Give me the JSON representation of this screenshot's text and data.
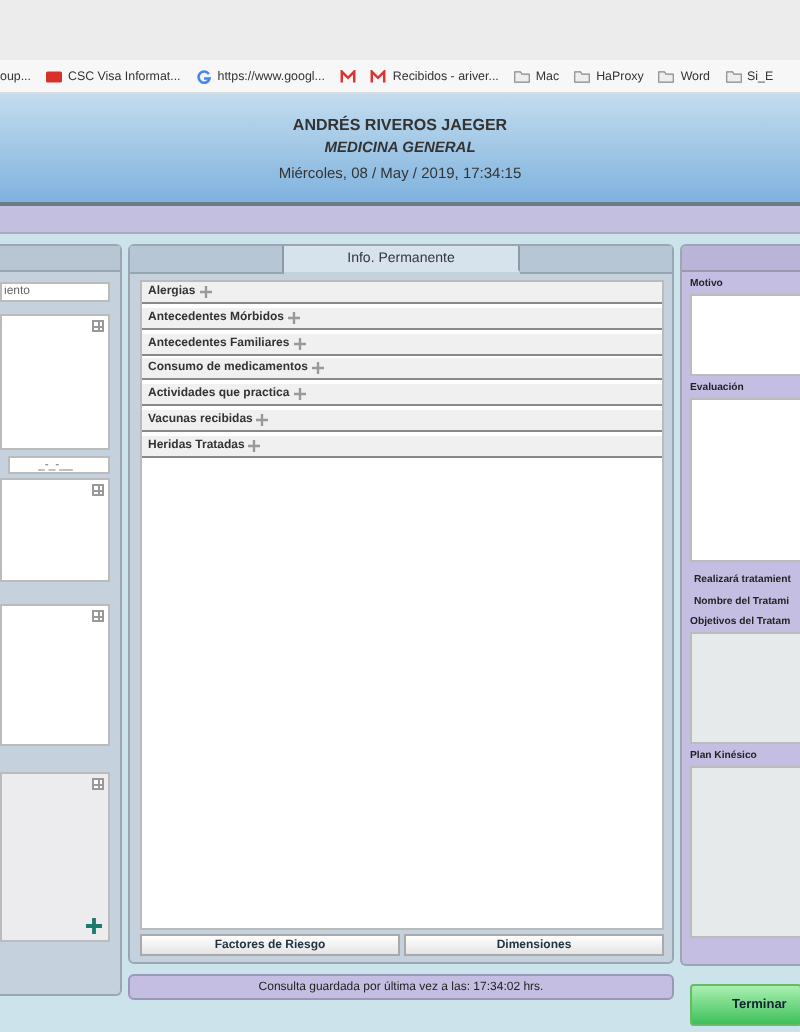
{
  "bookmarks": [
    {
      "kind": "plain",
      "label": "oup..."
    },
    {
      "kind": "card",
      "label": "CSC Visa Informat..."
    },
    {
      "kind": "google",
      "label": "https://www.googl..."
    },
    {
      "kind": "mail"
    },
    {
      "kind": "mail",
      "label": "Recibidos - ariver..."
    },
    {
      "kind": "folder",
      "label": "Mac"
    },
    {
      "kind": "folder",
      "label": "HaProxy"
    },
    {
      "kind": "folder",
      "label": "Word"
    },
    {
      "kind": "folder",
      "label": "Si_E"
    }
  ],
  "header": {
    "name": "ANDRÉS RIVEROS JAEGER",
    "specialty": "MEDICINA GENERAL",
    "datetime": "Miércoles, 08 / May / 2019, 17:34:15"
  },
  "left_panel": {
    "search": {
      "placeholder": "iento"
    },
    "date_field": {
      "placeholder": "_-_-__"
    }
  },
  "middle_panel": {
    "tabs": [
      {
        "label": "Info. Permanente",
        "selected": true
      }
    ],
    "sections": [
      "Alergias",
      "Antecedentes Mórbidos",
      "Antecedentes Familiares",
      "Consumo de medicamentos",
      "Actividades que practica",
      "Vacunas recibidas",
      "Heridas Tratadas"
    ],
    "buttons": [
      "Factores de Riesgo",
      "Dimensiones"
    ]
  },
  "status": "Consulta guardada por última vez a las: 17:34:02 hrs.",
  "right_panel": {
    "fields": [
      {
        "label": "Motivo",
        "kind": "textarea",
        "disabled": false
      },
      {
        "label": "Evaluación",
        "kind": "textarea",
        "disabled": false
      },
      {
        "label": "Realizará tratamient",
        "kind": "line"
      },
      {
        "label": "Nombre del Tratami",
        "kind": "line"
      },
      {
        "label": "Objetivos del Tratam",
        "kind": "textarea",
        "disabled": true
      },
      {
        "label": "Plan Kinésico",
        "kind": "textarea",
        "disabled": true
      }
    ],
    "finish_button": "Terminar"
  }
}
